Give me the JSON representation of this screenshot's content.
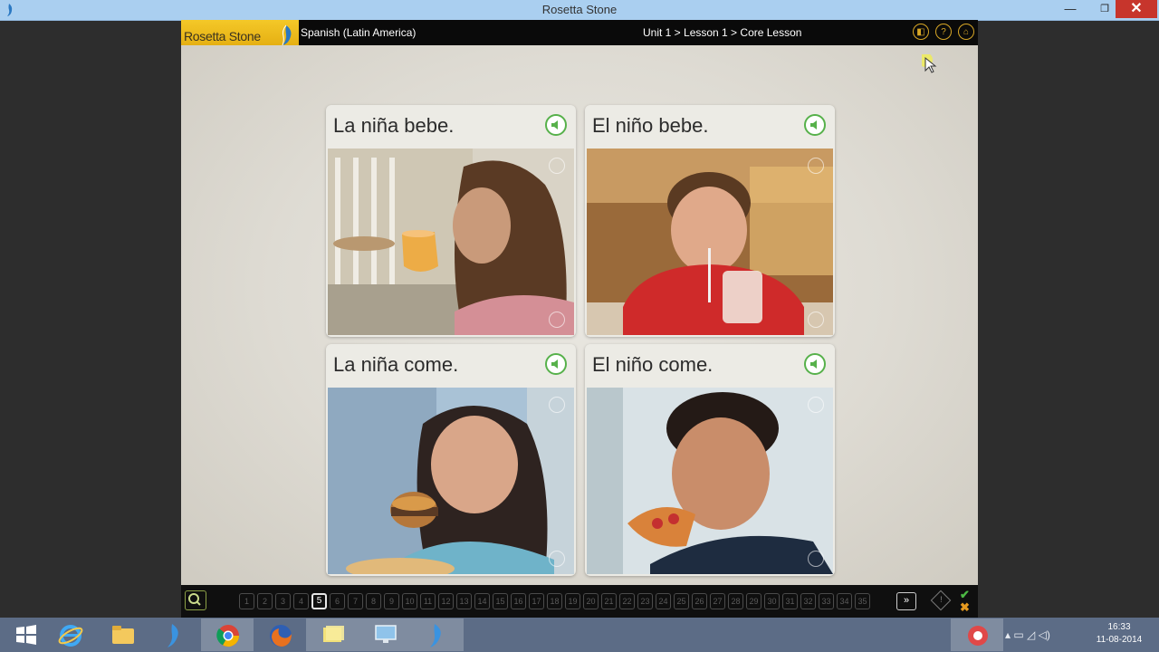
{
  "window": {
    "title": "Rosetta Stone"
  },
  "app": {
    "logo": "Rosetta Stone",
    "language": "Spanish (Latin America)",
    "breadcrumb": "Unit 1 > Lesson 1 > Core Lesson"
  },
  "cards": [
    {
      "caption": "La niña bebe."
    },
    {
      "caption": "El niño bebe."
    },
    {
      "caption": "La niña come."
    },
    {
      "caption": "El niño come."
    }
  ],
  "navigation": {
    "pages": [
      "1",
      "2",
      "3",
      "4",
      "5",
      "6",
      "7",
      "8",
      "9",
      "10",
      "11",
      "12",
      "13",
      "14",
      "15",
      "16",
      "17",
      "18",
      "19",
      "20",
      "21",
      "22",
      "23",
      "24",
      "25",
      "26",
      "27",
      "28",
      "29",
      "30",
      "31",
      "32",
      "33",
      "34",
      "35"
    ],
    "current_page": "5",
    "next_icon": "»"
  },
  "taskbar": {
    "clock_time": "16:33",
    "clock_date": "11-08-2014"
  },
  "colors": {
    "accent": "#f4c828",
    "audio_green": "#57b14b"
  }
}
